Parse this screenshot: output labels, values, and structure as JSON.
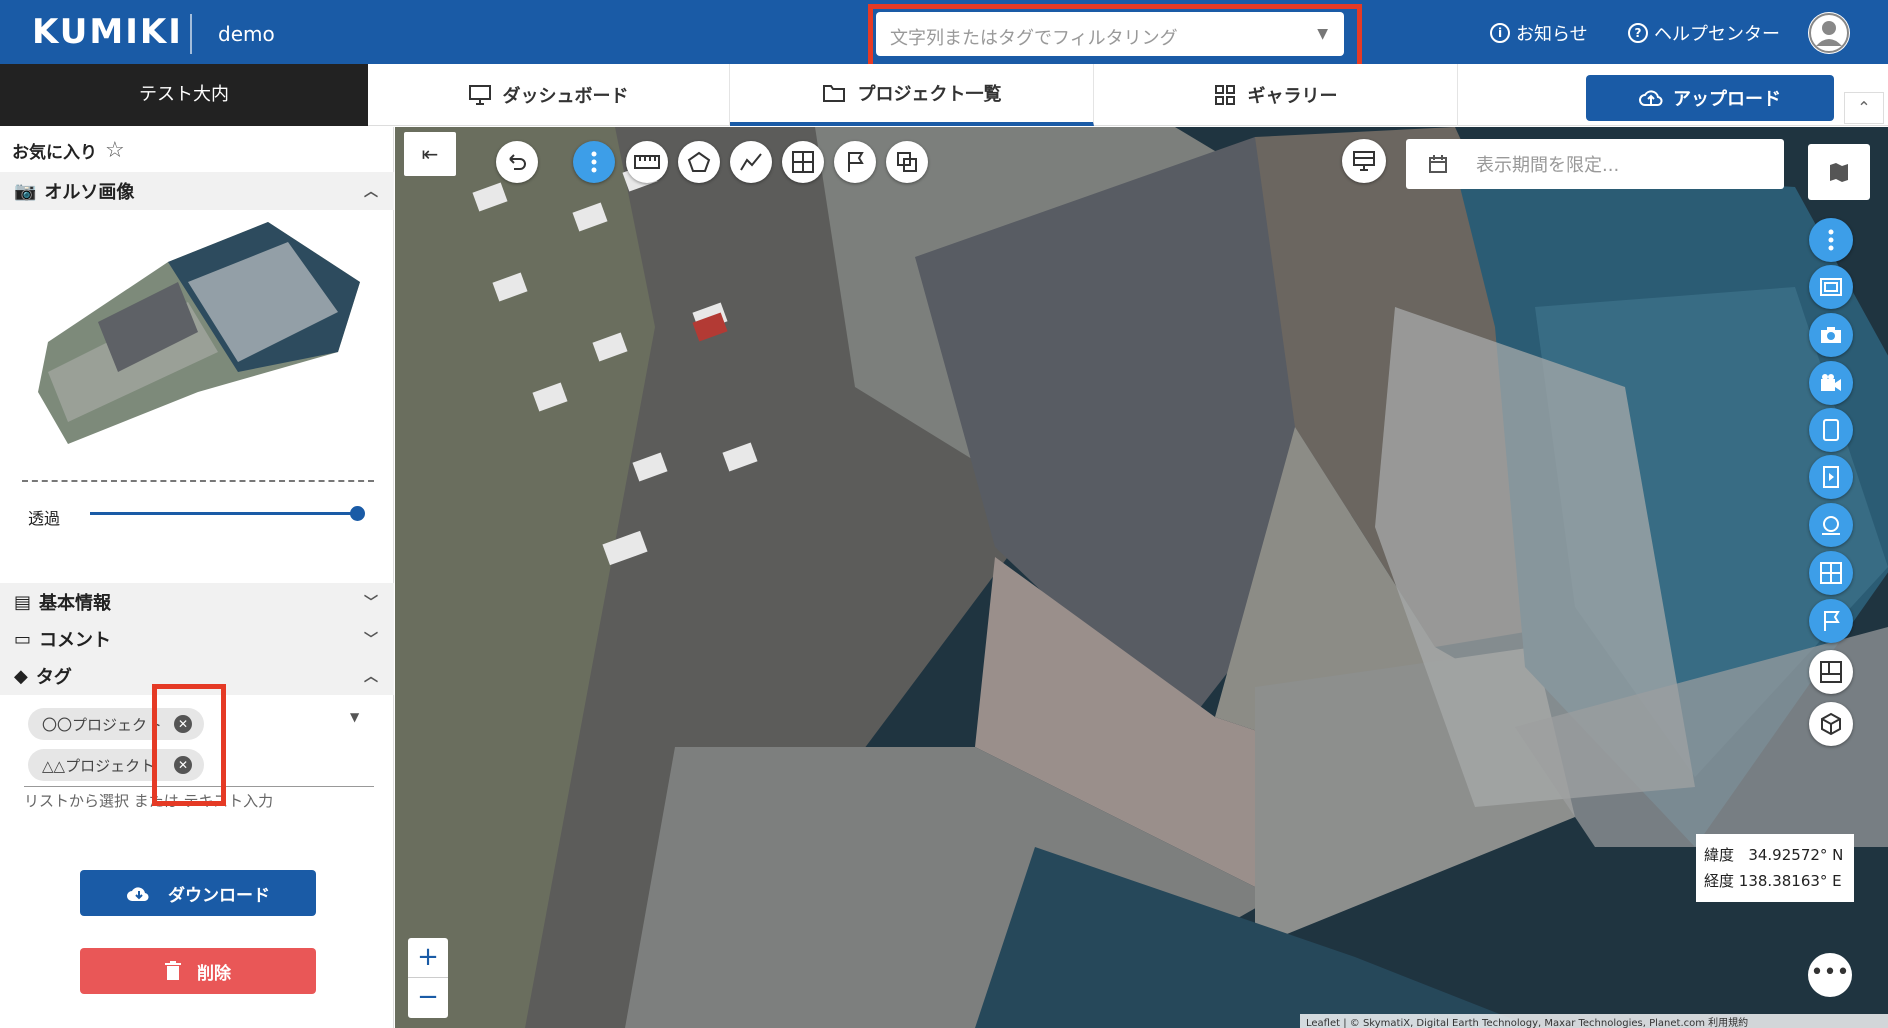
{
  "header": {
    "logo": "KUMIKI",
    "org": "demo",
    "filter_placeholder": "文字列またはタグでフィルタリング",
    "notice": "お知らせ",
    "help": "ヘルプセンター"
  },
  "nav": {
    "project_name": "テスト大内",
    "tabs": [
      {
        "label": "ダッシュボード",
        "icon": "monitor-icon"
      },
      {
        "label": "プロジェクト一覧",
        "icon": "folder-icon",
        "active": true
      },
      {
        "label": "ギャラリー",
        "icon": "grid-icon"
      }
    ],
    "upload": "アップロード"
  },
  "sidebar": {
    "favorite": "お気に入り",
    "ortho_title": "オルソ画像",
    "transparency": "透過",
    "transparency_value": 1.0,
    "basic_info": "基本情報",
    "comment": "コメント",
    "tags_title": "タグ",
    "tags": [
      "〇〇プロジェクト",
      "△△プロジェクト"
    ],
    "tag_hint": "リストから選択 または テキスト入力",
    "download": "ダウンロード",
    "delete": "削除"
  },
  "map": {
    "date_placeholder": "表示期間を限定...",
    "lat_label": "緯度",
    "lat": "34.92572° N",
    "lon_label": "経度",
    "lon": "138.38163° E",
    "zoom_in": "+",
    "zoom_out": "−",
    "attribution": "Leaflet | © SkymatiX, Digital Earth Technology, Maxar Technologies, Planet.com 利用規約"
  },
  "colors": {
    "brand": "#1a5ba6",
    "accent": "#3d9ee8",
    "danger": "#e95757",
    "highlight": "#e53a25"
  }
}
